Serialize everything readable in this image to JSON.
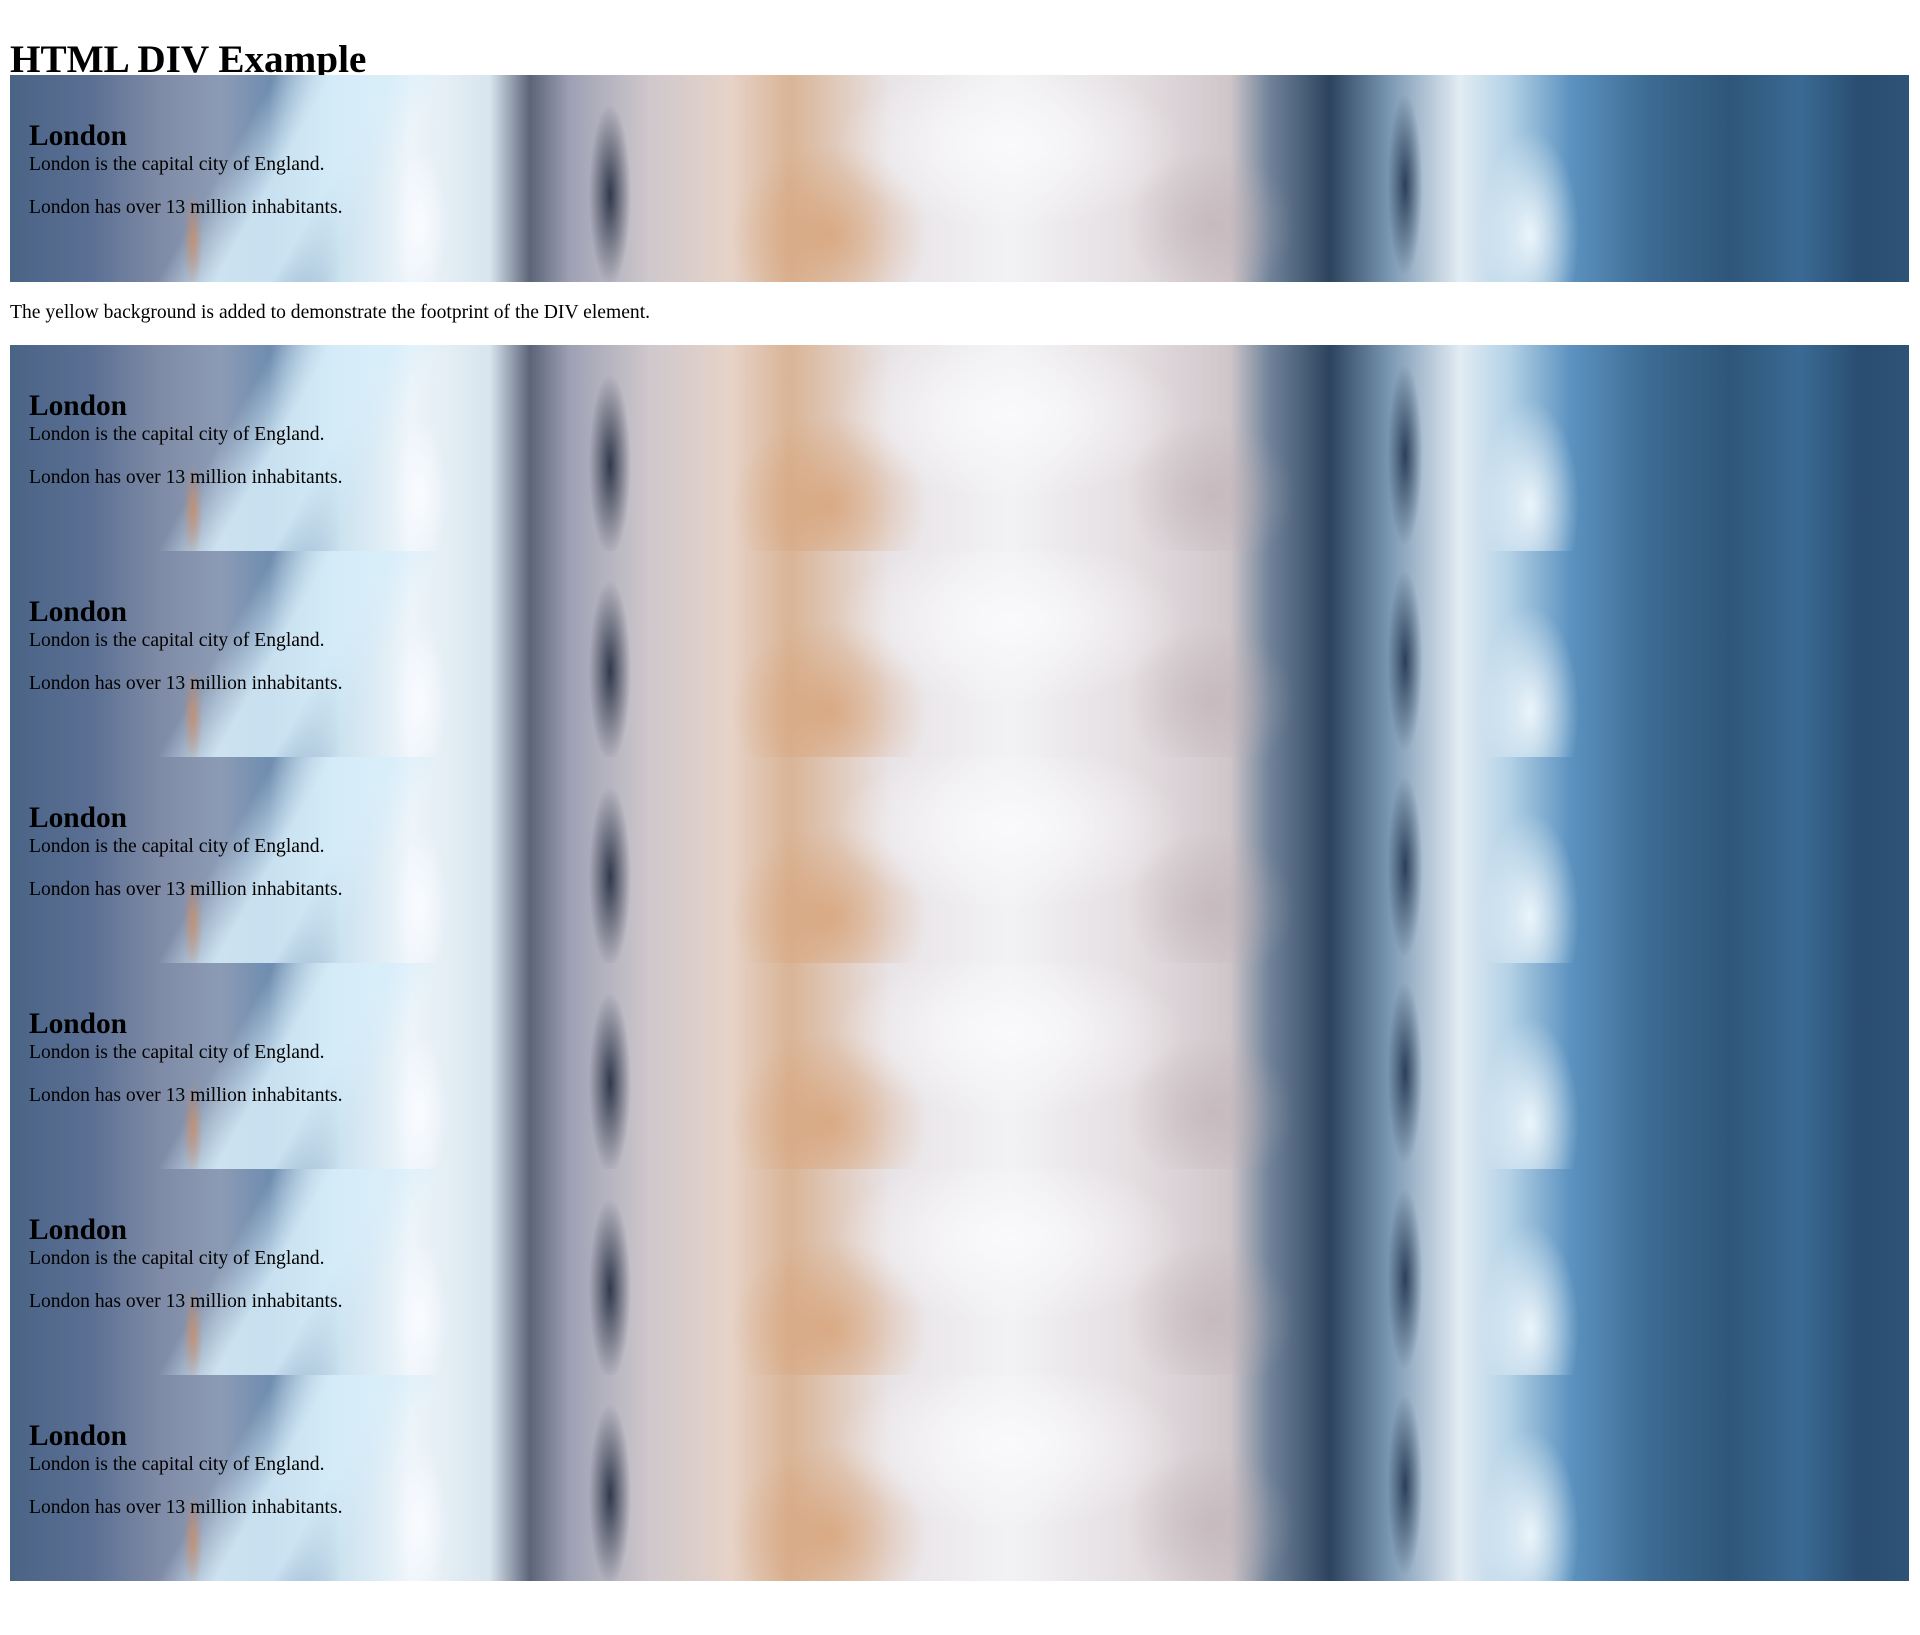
{
  "page": {
    "title": "HTML DIV Example",
    "note": "The yellow background is added to demonstrate the footprint of the DIV element."
  },
  "blocks": [
    {
      "heading": "London",
      "line1": "London is the capital city of England.",
      "line2": "London has over 13 million inhabitants."
    },
    {
      "heading": "London",
      "line1": "London is the capital city of England.",
      "line2": "London has over 13 million inhabitants."
    },
    {
      "heading": "London",
      "line1": "London is the capital city of England.",
      "line2": "London has over 13 million inhabitants."
    },
    {
      "heading": "London",
      "line1": "London is the capital city of England.",
      "line2": "London has over 13 million inhabitants."
    },
    {
      "heading": "London",
      "line1": "London is the capital city of England.",
      "line2": "London has over 13 million inhabitants."
    },
    {
      "heading": "London",
      "line1": "London is the capital city of England.",
      "line2": "London has over 13 million inhabitants."
    },
    {
      "heading": "London",
      "line1": "London is the capital city of England.",
      "line2": "London has over 13 million inhabitants."
    }
  ]
}
